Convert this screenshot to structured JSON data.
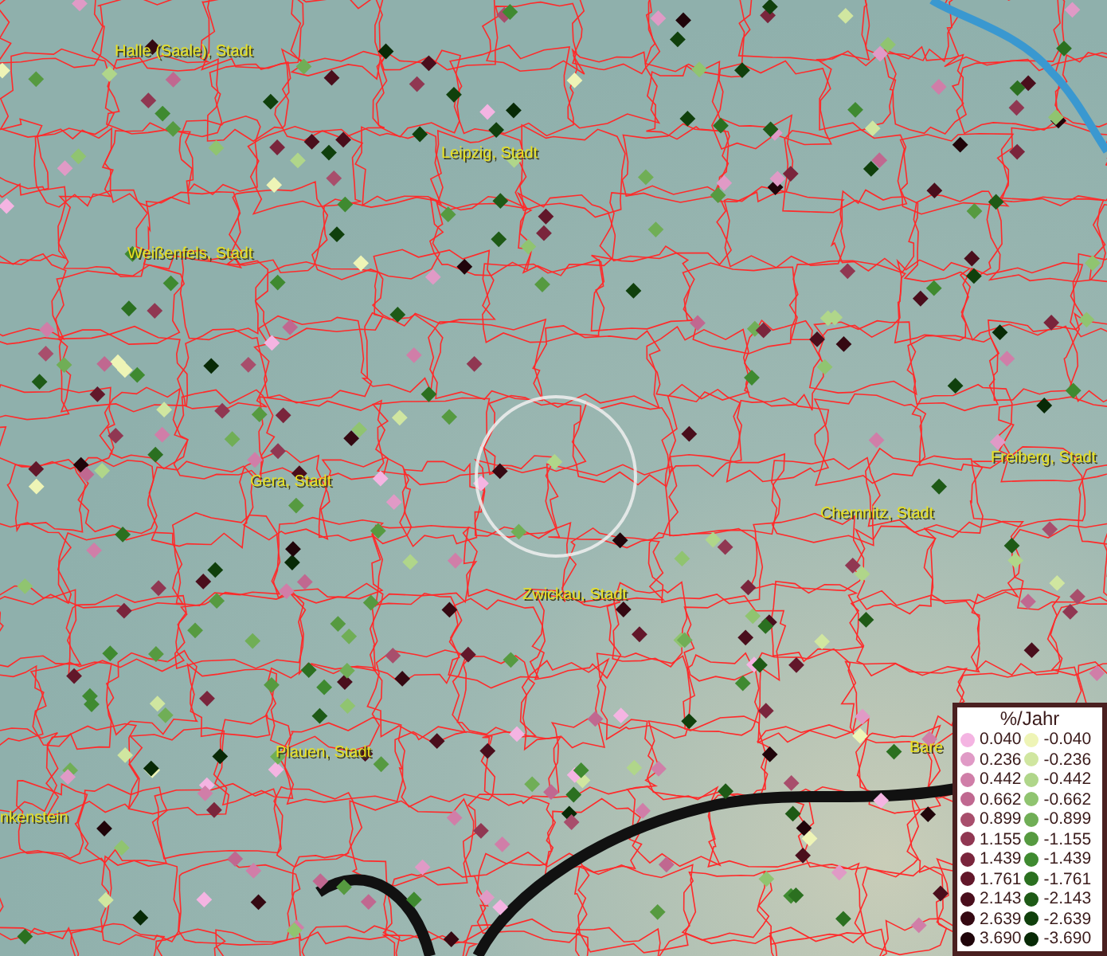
{
  "map": {
    "places": [
      {
        "label": "Halle (Saale), Stadt"
      },
      {
        "label": "Leipzig, Stadt"
      },
      {
        "label": "Weißenfels, Stadt"
      },
      {
        "label": "Gera, Stadt"
      },
      {
        "label": "Freiberg, Stadt"
      },
      {
        "label": "Chemnitz, Stadt"
      },
      {
        "label": "Zwickau, Stadt"
      },
      {
        "label": "Plauen, Stadt"
      },
      {
        "label": "Bare"
      },
      {
        "label": "nkenstein"
      }
    ]
  },
  "legend": {
    "title": "%/Jahr",
    "positive": [
      {
        "value": "0.040",
        "color": "#f4b4e2"
      },
      {
        "value": "0.236",
        "color": "#e09ac6"
      },
      {
        "value": "0.442",
        "color": "#d07ea8"
      },
      {
        "value": "0.662",
        "color": "#c06890"
      },
      {
        "value": "0.899",
        "color": "#a84e6c"
      },
      {
        "value": "1.155",
        "color": "#903752"
      },
      {
        "value": "1.439",
        "color": "#7a253c"
      },
      {
        "value": "1.761",
        "color": "#62172a"
      },
      {
        "value": "2.143",
        "color": "#4a0e1c"
      },
      {
        "value": "2.639",
        "color": "#350912"
      },
      {
        "value": "3.690",
        "color": "#20050a"
      }
    ],
    "negative": [
      {
        "value": "-0.040",
        "color": "#eef4b6"
      },
      {
        "value": "-0.236",
        "color": "#d0e6a0"
      },
      {
        "value": "-0.442",
        "color": "#b0d68a"
      },
      {
        "value": "-0.662",
        "color": "#90c470"
      },
      {
        "value": "-0.899",
        "color": "#70ae56"
      },
      {
        "value": "-1.155",
        "color": "#569a40"
      },
      {
        "value": "-1.439",
        "color": "#3f8a30"
      },
      {
        "value": "-1.761",
        "color": "#2b7020"
      },
      {
        "value": "-2.143",
        "color": "#1e5a16"
      },
      {
        "value": "-2.639",
        "color": "#10400c"
      },
      {
        "value": "-3.690",
        "color": "#082a06"
      }
    ]
  }
}
